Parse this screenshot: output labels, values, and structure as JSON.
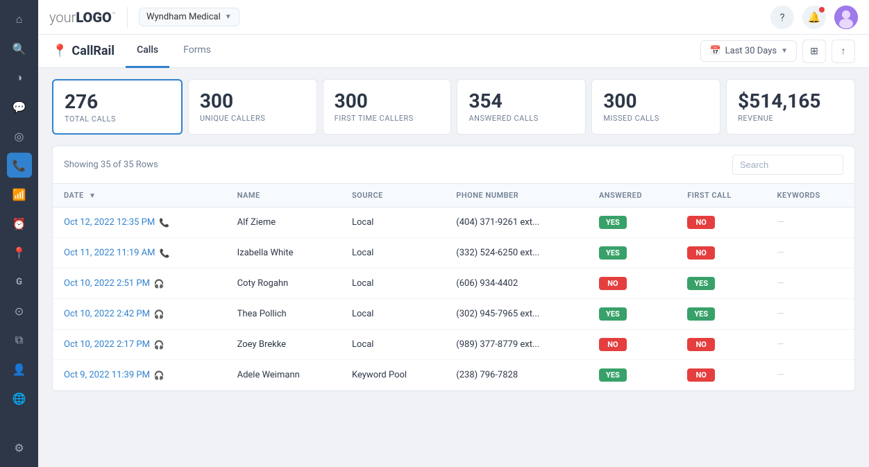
{
  "topbar": {
    "logo_prefix": "your",
    "logo_bold": "LOGO",
    "logo_tm": "™",
    "org_name": "Wyndham Medical",
    "help_label": "?",
    "notifications_label": "🔔",
    "avatar_label": "U"
  },
  "subnav": {
    "brand_icon": "📍",
    "brand_name": "CallRail",
    "tabs": [
      {
        "id": "calls",
        "label": "Calls",
        "active": true
      },
      {
        "id": "forms",
        "label": "Forms",
        "active": false
      }
    ],
    "date_filter": "Last 30 Days",
    "filter_icon": "⊞",
    "share_icon": "↑"
  },
  "stats": [
    {
      "number": "276",
      "label": "Total Calls",
      "active": true
    },
    {
      "number": "300",
      "label": "Unique Callers"
    },
    {
      "number": "300",
      "label": "First Time Callers"
    },
    {
      "number": "354",
      "label": "Answered Calls"
    },
    {
      "number": "300",
      "label": "Missed Calls"
    },
    {
      "number": "$514,165",
      "label": "Revenue"
    }
  ],
  "table": {
    "showing_text": "Showing 35 of 35 Rows",
    "search_placeholder": "Search",
    "columns": [
      {
        "id": "date",
        "label": "DATE",
        "sortable": true
      },
      {
        "id": "name",
        "label": "NAME",
        "sortable": false
      },
      {
        "id": "source",
        "label": "SOURCE",
        "sortable": false
      },
      {
        "id": "phone",
        "label": "PHONE NUMBER",
        "sortable": false
      },
      {
        "id": "answered",
        "label": "ANSWERED",
        "sortable": false
      },
      {
        "id": "first_call",
        "label": "FIRST CALL",
        "sortable": false
      },
      {
        "id": "keywords",
        "label": "KEYWORDS",
        "sortable": false
      }
    ],
    "rows": [
      {
        "date": "Oct 12, 2022 12:35 PM",
        "call_icon": "📞",
        "name": "Alf Zieme",
        "source": "Local",
        "phone": "(404) 371-9261 ext...",
        "answered": "YES",
        "first_call": "NO",
        "keywords": "—"
      },
      {
        "date": "Oct 11, 2022 11:19 AM",
        "call_icon": "📞",
        "name": "Izabella White",
        "source": "Local",
        "phone": "(332) 524-6250 ext...",
        "answered": "YES",
        "first_call": "NO",
        "keywords": "—"
      },
      {
        "date": "Oct 10, 2022 2:51 PM",
        "call_icon": "🎧",
        "name": "Coty Rogahn",
        "source": "Local",
        "phone": "(606) 934-4402",
        "answered": "NO",
        "first_call": "YES",
        "keywords": "—"
      },
      {
        "date": "Oct 10, 2022 2:42 PM",
        "call_icon": "🎧",
        "name": "Thea Pollich",
        "source": "Local",
        "phone": "(302) 945-7965 ext...",
        "answered": "YES",
        "first_call": "YES",
        "keywords": "—"
      },
      {
        "date": "Oct 10, 2022 2:17 PM",
        "call_icon": "🎧",
        "name": "Zoey Brekke",
        "source": "Local",
        "phone": "(989) 377-8779 ext...",
        "answered": "NO",
        "first_call": "NO",
        "keywords": "—"
      },
      {
        "date": "Oct 9, 2022 11:39 PM",
        "call_icon": "🎧",
        "name": "Adele Weimann",
        "source": "Keyword Pool",
        "phone": "(238) 796-7828",
        "answered": "YES",
        "first_call": "NO",
        "keywords": "—"
      }
    ]
  },
  "sidebar": {
    "items": [
      {
        "id": "home",
        "icon": "⌂",
        "active": false
      },
      {
        "id": "search",
        "icon": "🔍",
        "active": false
      },
      {
        "id": "chart",
        "icon": "◑",
        "active": false
      },
      {
        "id": "message",
        "icon": "💬",
        "active": false
      },
      {
        "id": "tag",
        "icon": "◎",
        "active": false
      },
      {
        "id": "phone",
        "icon": "📞",
        "active": true
      },
      {
        "id": "signal",
        "icon": "📶",
        "active": false
      },
      {
        "id": "clock",
        "icon": "⏰",
        "active": false
      },
      {
        "id": "pin",
        "icon": "📍",
        "active": false
      },
      {
        "id": "g",
        "icon": "Ⓖ",
        "active": false
      },
      {
        "id": "circle",
        "icon": "⊙",
        "active": false
      },
      {
        "id": "layers",
        "icon": "⧉",
        "active": false
      },
      {
        "id": "users",
        "icon": "👤",
        "active": false
      },
      {
        "id": "globe",
        "icon": "🌐",
        "active": false
      },
      {
        "id": "settings",
        "icon": "⚙",
        "active": false
      }
    ]
  }
}
